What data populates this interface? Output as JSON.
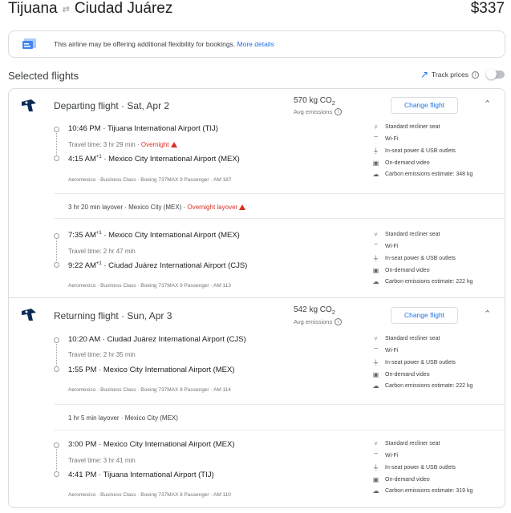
{
  "header": {
    "origin": "Tijuana",
    "destination": "Ciudad Juárez",
    "price": "$337"
  },
  "banner": {
    "text": "This airline may be offering additional flexibility for bookings.",
    "link": "More details"
  },
  "selected": {
    "title": "Selected flights",
    "track_label": "Track prices"
  },
  "departing": {
    "title": "Departing flight",
    "date": "Sat, Apr 2",
    "co2": "570 kg CO",
    "co2_sub": "2",
    "avg": "Avg emissions",
    "change": "Change flight",
    "seg1": {
      "dep_time": "10:46 PM",
      "dep_airport": "Tijuana International Airport (TIJ)",
      "travel": "Travel time: 3 hr 29 min",
      "overnight": "Overnight",
      "arr_time": "4:15 AM",
      "arr_sup": "+1",
      "arr_airport": "Mexico City International Airport (MEX)",
      "meta": "Aeromexico · Business Class · Boeing 737MAX 9 Passenger · AM 187",
      "amenities": [
        "Standard recliner seat",
        "Wi-Fi",
        "In-seat power & USB outlets",
        "On-demand video",
        "Carbon emissions estimate: 348 kg"
      ]
    },
    "layover": {
      "text": "3 hr 20 min layover · Mexico City (MEX)",
      "warn": "Overnight layover"
    },
    "seg2": {
      "dep_time": "7:35 AM",
      "dep_sup": "+1",
      "dep_airport": "Mexico City International Airport (MEX)",
      "travel": "Travel time: 2 hr 47 min",
      "arr_time": "9:22 AM",
      "arr_sup": "+1",
      "arr_airport": "Ciudad Juárez International Airport (CJS)",
      "meta": "Aeromexico · Business Class · Boeing 737MAX 9 Passenger · AM 113",
      "amenities": [
        "Standard recliner seat",
        "Wi-Fi",
        "In-seat power & USB outlets",
        "On-demand video",
        "Carbon emissions estimate: 222 kg"
      ]
    }
  },
  "returning": {
    "title": "Returning flight",
    "date": "Sun, Apr 3",
    "co2": "542 kg CO",
    "co2_sub": "2",
    "avg": "Avg emissions",
    "change": "Change flight",
    "seg1": {
      "dep_time": "10:20 AM",
      "dep_airport": "Ciudad Juárez International Airport (CJS)",
      "travel": "Travel time: 2 hr 35 min",
      "arr_time": "1:55 PM",
      "arr_airport": "Mexico City International Airport (MEX)",
      "meta": "Aeromexico · Business Class · Boeing 737MAX 8 Passenger · AM 114",
      "amenities": [
        "Standard recliner seat",
        "Wi-Fi",
        "In-seat power & USB outlets",
        "On-demand video",
        "Carbon emissions estimate: 222 kg"
      ]
    },
    "layover": {
      "text": "1 hr 5 min layover · Mexico City (MEX)"
    },
    "seg2": {
      "dep_time": "3:00 PM",
      "dep_airport": "Mexico City International Airport (MEX)",
      "travel": "Travel time: 3 hr 41 min",
      "arr_time": "4:41 PM",
      "arr_airport": "Tijuana International Airport (TIJ)",
      "meta": "Aeromexico · Business Class · Boeing 737MAX 8 Passenger · AM 110",
      "amenities": [
        "Standard recliner seat",
        "Wi-Fi",
        "In-seat power & USB outlets",
        "On-demand video",
        "Carbon emissions estimate: 319 kg"
      ]
    }
  },
  "colors": {
    "link": "#1a73e8",
    "warning": "#d93025",
    "border": "#dadce0"
  }
}
